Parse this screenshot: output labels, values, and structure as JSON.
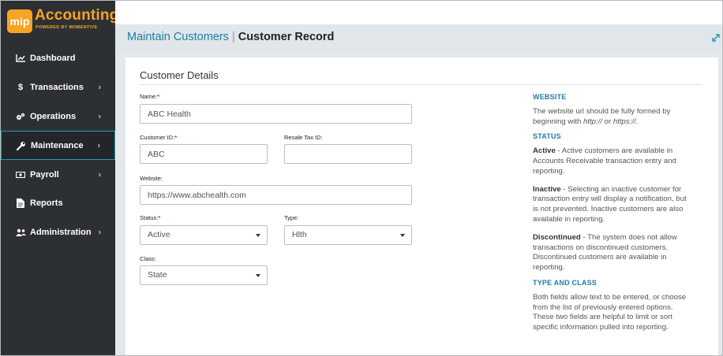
{
  "brand": {
    "badge": "mip",
    "title": "Accounting",
    "subtitle": "POWERED BY MOMENTIVE",
    "accent": "#f7a324"
  },
  "sidebar": {
    "items": [
      {
        "label": "Dashboard",
        "icon": "chart-line-icon",
        "chevron": false,
        "active": false
      },
      {
        "label": "Transactions",
        "icon": "dollar-icon",
        "chevron": true,
        "active": false
      },
      {
        "label": "Operations",
        "icon": "gears-icon",
        "chevron": true,
        "active": false
      },
      {
        "label": "Maintenance",
        "icon": "wrench-icon",
        "chevron": true,
        "active": true
      },
      {
        "label": "Payroll",
        "icon": "money-icon",
        "chevron": true,
        "active": false
      },
      {
        "label": "Reports",
        "icon": "file-icon",
        "chevron": false,
        "active": false
      },
      {
        "label": "Administration",
        "icon": "users-icon",
        "chevron": true,
        "active": false
      }
    ]
  },
  "header": {
    "parent": "Maintain Customers",
    "separator": "|",
    "current": "Customer Record"
  },
  "form": {
    "section_title": "Customer Details",
    "name": {
      "label": "Name:",
      "required": "*",
      "value": "ABC Health"
    },
    "customer_id": {
      "label": "Customer ID:",
      "required": "*",
      "value": "ABC"
    },
    "resale_tax_id": {
      "label": "Resale Tax ID:",
      "value": ""
    },
    "website": {
      "label": "Website:",
      "value": "https://www.abchealth.com"
    },
    "status": {
      "label": "Status:",
      "required": "*",
      "value": "Active"
    },
    "type": {
      "label": "Type:",
      "value": "Hlth"
    },
    "class": {
      "label": "Class:",
      "value": "State"
    }
  },
  "help": {
    "website_heading": "WEBSITE",
    "website_text_1": "The website url should be fully formed by beginning with ",
    "website_http": "http://",
    "website_or": " or ",
    "website_https": "https://",
    "website_end": ".",
    "status_heading": "STATUS",
    "active_term": "Active",
    "active_text": " - Active customers are available in Accounts Receivable transaction entry and reporting.",
    "inactive_term": "Inactive",
    "inactive_text": " - Selecting an inactive customer for transaction entry will display a notification, but is not prevented. Inactive customers are also available in reporting.",
    "discontinued_term": "Discontinued",
    "discontinued_text": " - The system does not allow transactions on discontinued customers. Discontinued customers are available in reporting.",
    "type_class_heading": "TYPE AND CLASS",
    "type_class_text": "Both fields allow text to be entered, or choose from the list of previously entered options. These two fields are helpful to limit or sort specific information pulled into reporting."
  }
}
